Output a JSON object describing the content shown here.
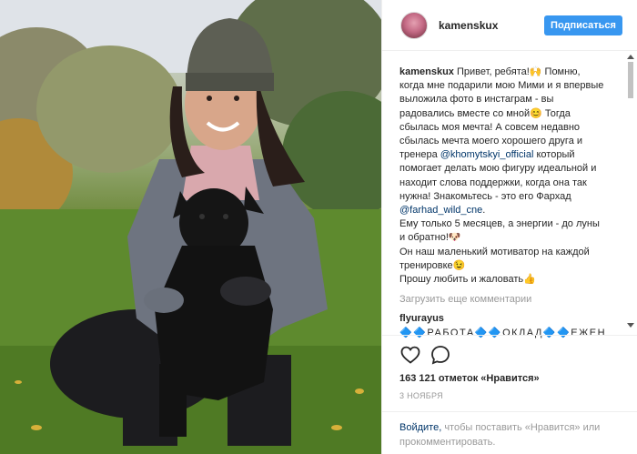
{
  "post": {
    "username": "kamenskux",
    "follow_label": "Подписаться"
  },
  "caption": {
    "author": "kamenskux",
    "part1": " Привет, ребята!🙌 Помню, когда мне подарили мою Мими и я впервые выложила фото в инстаграм - вы радовались вместе со мной😊 Тогда сбылась моя мечта! А совсем недавно сбылась мечта моего хорошего друга и тренера ",
    "mention1": "@khomytskyi_official",
    "part2": " который помогает делать мою фигуру идеальной и находит слова поддержки, когда она так нужна! Знакомьтесь - это его Фархад ",
    "mention2": "@farhad_wild_cne",
    "part3": ".\nЕму только 5 месяцев, а энергии - до луны и обратно!🐶\nОн наш маленький мотиватор на каждой тренировке😉\nПрошу любить и жаловать👍"
  },
  "load_more_label": "Загрузить еще комментарии",
  "comment2": {
    "author": "flyurayus",
    "text": " 🔷🔷РАБОТА🔷🔷ОКЛАД🔷🔷ЕЖЕНЕДЕЛЬНЫЕ ВЫПЛАТЫ🔷🔷НА КАРТУ"
  },
  "likes": {
    "text": "163 121 отметок «Нравится»"
  },
  "date_text": "3 НОЯБРЯ",
  "login": {
    "link": "Войдите,",
    "text": " чтобы поставить «Нравится» или прокомментировать."
  },
  "icons": {
    "like": "heart-outline-icon",
    "comment": "speech-bubble-icon"
  },
  "colors": {
    "accent": "#3897f0",
    "link": "#003569",
    "muted": "#999999"
  }
}
